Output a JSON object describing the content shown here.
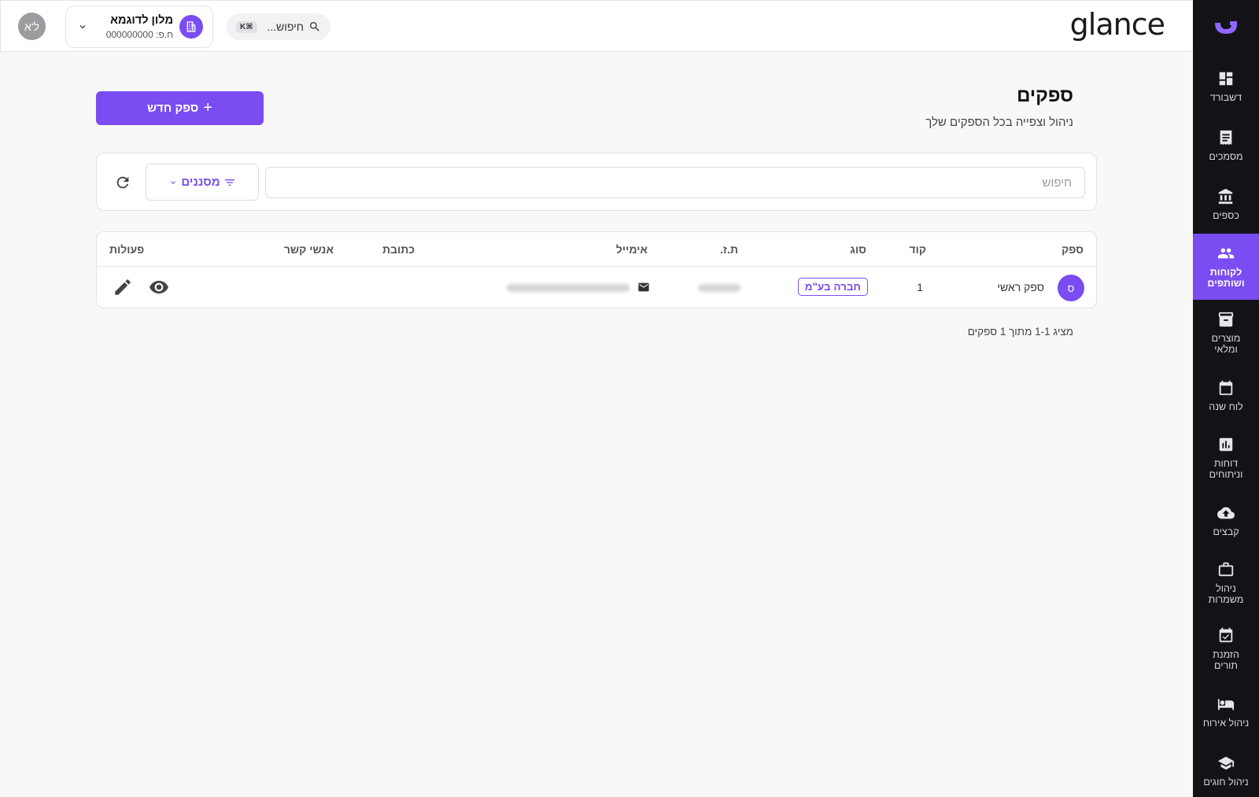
{
  "brand": {
    "name": "glance"
  },
  "user": {
    "initials": "ל'א"
  },
  "org": {
    "name": "מלון לדוגמא",
    "sub": "ח.פ: 000000000"
  },
  "top_search": {
    "label": "חיפוש...",
    "shortcut": "⌘K"
  },
  "sidebar": {
    "items": [
      {
        "label": "דשבורד",
        "icon": "dashboard-icon"
      },
      {
        "label": "מסמכים",
        "icon": "document-icon"
      },
      {
        "label": "כספים",
        "icon": "bank-icon"
      },
      {
        "label": "לקוחות\nושותפים",
        "icon": "people-icon",
        "active": true
      },
      {
        "label": "מוצרים\nומלאי",
        "icon": "archive-icon"
      },
      {
        "label": "לוח שנה",
        "icon": "calendar-icon"
      },
      {
        "label": "דוחות\nוניתוחים",
        "icon": "report-icon"
      },
      {
        "label": "קבצים",
        "icon": "cloud-upload-icon"
      },
      {
        "label": "ניהול\nמשמרות",
        "icon": "briefcase-icon"
      },
      {
        "label": "הזמנת\nתורים",
        "icon": "calendar-check-icon"
      },
      {
        "label": "ניהול אירוח",
        "icon": "bed-icon"
      },
      {
        "label": "ניהול חוגים",
        "icon": "school-icon"
      }
    ]
  },
  "page": {
    "title": "ספקים",
    "subtitle": "ניהול וצפייה בכל הספקים שלך",
    "new_button": "ספק חדש",
    "search_placeholder": "חיפוש",
    "filters_label": "מסננים",
    "count_text": "מציג 1-1 מתוך 1 ספקים"
  },
  "table": {
    "headers": {
      "supplier": "ספק",
      "code": "קוד",
      "type": "סוג",
      "id": "ת.ז.",
      "email": "אימייל",
      "address": "כתובת",
      "contacts": "אנשי קשר",
      "actions": "פעולות"
    },
    "rows": [
      {
        "initial": "ס",
        "name": "ספק ראשי",
        "code": "1",
        "type": "חברה בע\"מ"
      }
    ]
  },
  "colors": {
    "accent": "#7a4cf2",
    "sidebar_bg": "#131317"
  }
}
